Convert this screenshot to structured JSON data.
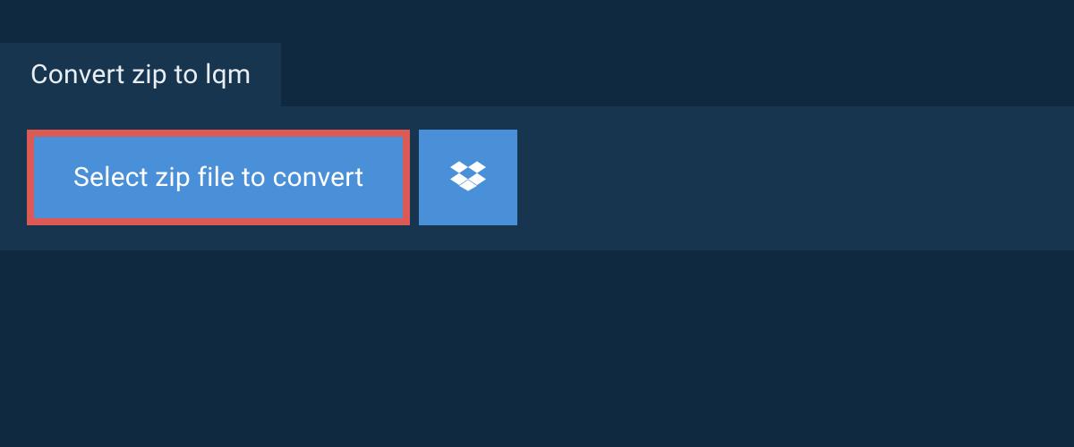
{
  "tab": {
    "title": "Convert zip to lqm"
  },
  "actions": {
    "select_label": "Select zip file to convert",
    "dropbox_icon": "dropbox-icon"
  },
  "colors": {
    "background": "#0f2940",
    "panel": "#17354f",
    "button": "#4a90d9",
    "highlight_border": "#dc5a55",
    "text": "#ffffff"
  }
}
